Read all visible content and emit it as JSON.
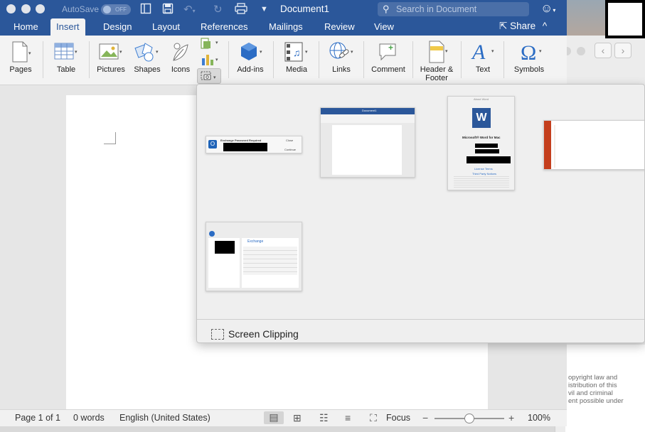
{
  "app": {
    "document_title": "Document1",
    "autosave_label": "AutoSave",
    "autosave_state": "OFF",
    "search_placeholder": "Search in Document",
    "share_label": "Share"
  },
  "tabs": [
    "Home",
    "Insert",
    "Design",
    "Layout",
    "References",
    "Mailings",
    "Review",
    "View"
  ],
  "active_tab": "Insert",
  "ribbon": {
    "pages": "Pages",
    "table": "Table",
    "pictures": "Pictures",
    "shapes": "Shapes",
    "icons": "Icons",
    "addins": "Add-ins",
    "media": "Media",
    "links": "Links",
    "comment": "Comment",
    "header_footer_1": "Header &",
    "header_footer_2": "Footer",
    "text": "Text",
    "symbols": "Symbols"
  },
  "screenshot_panel": {
    "screen_clipping_label": "Screen Clipping",
    "thumbnails": [
      {
        "name": "exchange-password-dialog",
        "lines": [
          "Exchange Password Required",
          "Close",
          "Continue"
        ]
      },
      {
        "name": "word-document-window",
        "lines": [
          "Document1"
        ]
      },
      {
        "name": "about-word-window",
        "lines": [
          "About Word",
          "Microsoft® Word for Mac",
          "License Terms",
          "Third Party Notices"
        ]
      },
      {
        "name": "template-gallery-window",
        "lines": []
      },
      {
        "name": "exchange-accounts-window",
        "lines": [
          "Exchange"
        ]
      }
    ]
  },
  "status": {
    "page": "Page 1 of 1",
    "words": "0 words",
    "language": "English (United States)",
    "focus": "Focus",
    "zoom": "100%",
    "zoom_level": 1.0
  },
  "background": {
    "text_lines": [
      "opyright law and",
      "istribution of this",
      "vil and criminal",
      "ent possible under"
    ]
  },
  "colors": {
    "title_bar": "#2b579a",
    "ribbon_bg": "#f3f3f3",
    "panel_bg": "#efefef",
    "accent_icon": "#2b6cc4"
  }
}
